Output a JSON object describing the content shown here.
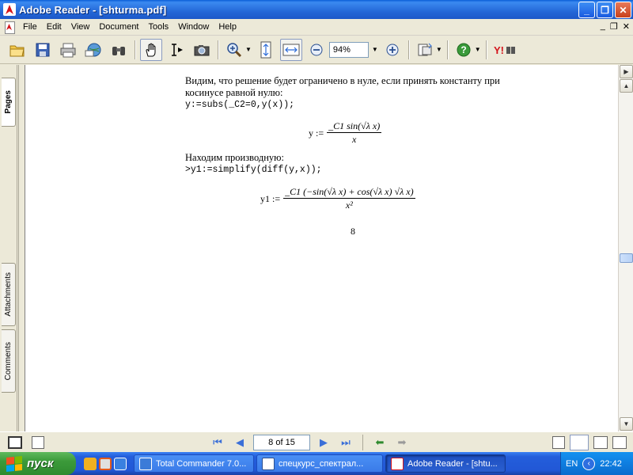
{
  "window": {
    "title": "Adobe Reader - [shturma.pdf]"
  },
  "menu": {
    "items": [
      "File",
      "Edit",
      "View",
      "Document",
      "Tools",
      "Window",
      "Help"
    ]
  },
  "toolbar": {
    "zoom_value": "94%"
  },
  "nav_tabs": {
    "pages": "Pages",
    "attachments": "Attachments",
    "comments": "Comments"
  },
  "document": {
    "para1": "Видим, что решение будет ограничено в нуле, если принять константу при косинусе равной нулю:",
    "code1": "y:=subs(_C2=0,y(x));",
    "formula1": {
      "lhs": "y :=",
      "numerator": "_C1 sin(√λ x)",
      "denominator": "x"
    },
    "para2": "Находим производную:",
    "code2": ">y1:=simplify(diff(y,x));",
    "formula2": {
      "lhs": "y1 :=",
      "numerator": "_C1 (−sin(√λ x) + cos(√λ x) √λ x)",
      "denominator": "x²"
    },
    "page_number": "8"
  },
  "statusbar": {
    "page_field": "8 of 15"
  },
  "taskbar": {
    "start_label": "пуск",
    "tasks": [
      "Total Commander 7.0...",
      "спецкурс_спектрал...",
      "Adobe Reader - [shtu..."
    ],
    "lang": "EN",
    "clock": "22:42"
  }
}
